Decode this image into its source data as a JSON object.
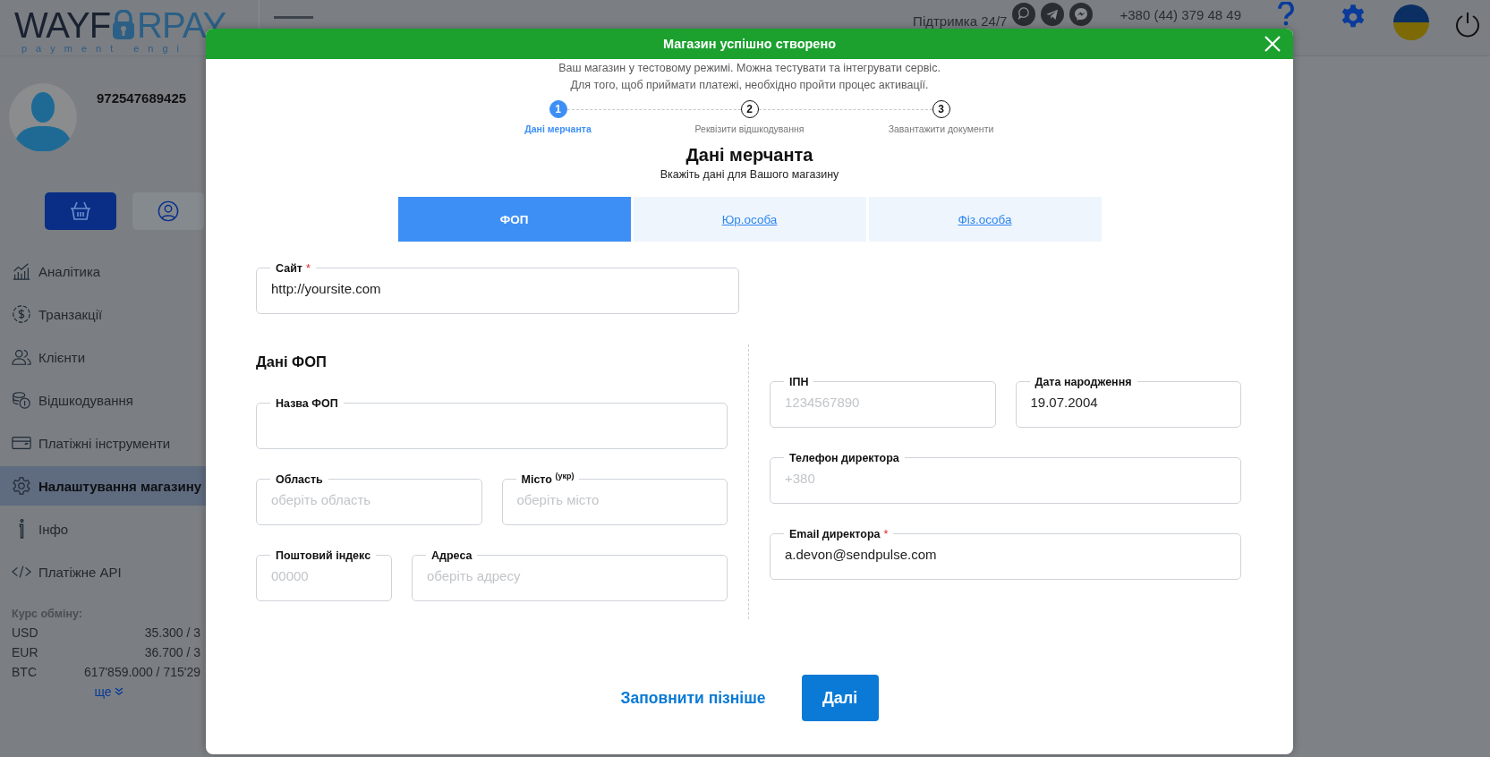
{
  "header": {
    "logo": {
      "left": "WAYF",
      "right": "RPAY",
      "tagline": "payment engi"
    },
    "support": "Підтримка 24/7",
    "phone": "+380 (44) 379 48 49"
  },
  "sidebar": {
    "account": "972547689425",
    "quick_buttons": [
      {
        "kind": "basket",
        "selected": true
      },
      {
        "kind": "user",
        "selected": false
      }
    ],
    "menu": [
      {
        "kind": "chart",
        "label": "Аналітика",
        "selected": false
      },
      {
        "kind": "dollar",
        "label": "Транзакції",
        "selected": false
      },
      {
        "kind": "people",
        "label": "Клієнти",
        "selected": false
      },
      {
        "kind": "coins",
        "label": "Відшкодування",
        "selected": false
      },
      {
        "kind": "card",
        "label": "Платіжні інструменти",
        "selected": false
      },
      {
        "kind": "gear",
        "label": "Налаштування магазину",
        "selected": true
      },
      {
        "kind": "info",
        "label": "Інфо",
        "selected": false
      },
      {
        "kind": "code",
        "label": "Платіжне API",
        "selected": false
      }
    ],
    "exchange": {
      "title": "Курс обміну:",
      "rates": [
        {
          "currency": "USD",
          "rate": "35.300 / 3"
        },
        {
          "currency": "EUR",
          "rate": "36.700 / 3"
        },
        {
          "currency": "BTC",
          "rate": "617'859.000 / 715'29"
        }
      ],
      "more": "ще"
    }
  },
  "modal": {
    "banner": "Магазин успішно створено",
    "notice": [
      "Ваш магазин у тестовому режимі. Можна тестувати та інтегрувати сервіс.",
      "Для того, щоб приймати платежі, необхідно пройти процес активації."
    ],
    "steps": [
      {
        "number": "1",
        "label": "Дані мерчанта",
        "selected": true
      },
      {
        "number": "2",
        "label": "Реквізити відшкодування",
        "selected": false
      },
      {
        "number": "3",
        "label": "Завантажити документи",
        "selected": false
      }
    ],
    "title": "Дані мерчанта",
    "subtitle": "Вкажіть дані для Вашого магазину",
    "tabs": [
      {
        "label": "ФОП",
        "selected": true
      },
      {
        "label": "Юр.особа",
        "selected": false
      },
      {
        "label": "Фіз.особа",
        "selected": false
      }
    ],
    "site_field": {
      "label": "Сайт",
      "mark": "*",
      "value": "http://yoursite.com"
    },
    "section_title": "Дані ФОП",
    "left_rows": [
      [
        {
          "label": "Назва ФОП"
        }
      ],
      [
        {
          "label": "Область",
          "placeholder": "оберіть область"
        },
        {
          "label": "Місто $^{(укр)}$",
          "placeholder": "оберіть місто"
        }
      ],
      [
        {
          "label": "Поштовий індекс",
          "placeholder": "00000"
        },
        {
          "label": "Адреса",
          "placeholder": "оберіть адресу"
        }
      ]
    ],
    "right_rows": [
      [
        {
          "label": "ІПН",
          "placeholder": "1234567890"
        },
        {
          "label": "Дата народження",
          "value": "19.07.2004"
        }
      ],
      [
        {
          "label": "Телефон директора",
          "placeholder": "+380"
        }
      ],
      [
        {
          "label": "Email директора",
          "mark": "*",
          "value": "a.devon@sendpulse.com"
        }
      ]
    ],
    "later": "Заповнити пізніше",
    "next": "Далі"
  }
}
